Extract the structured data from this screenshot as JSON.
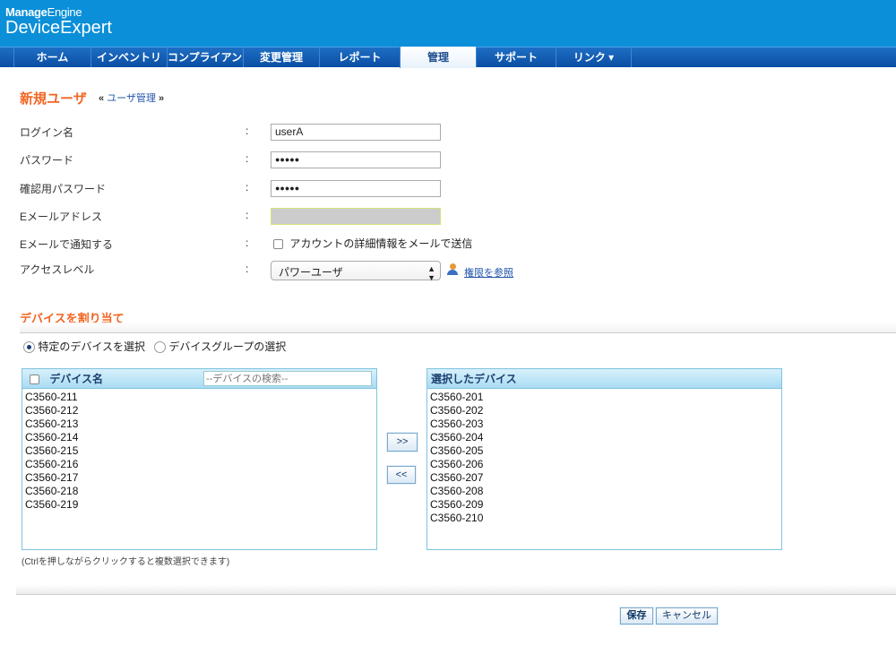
{
  "header": {
    "brand": "ManageEngine",
    "brand_bold": "Manage",
    "brand_light": "Engine",
    "product": "DeviceExpert"
  },
  "nav": {
    "tabs": [
      {
        "label": "ホーム"
      },
      {
        "label": "インベントリ"
      },
      {
        "label": "コンプライアンス"
      },
      {
        "label": "変更管理"
      },
      {
        "label": "レポート"
      },
      {
        "label": "管理",
        "active": true
      },
      {
        "label": "サポート"
      },
      {
        "label": "リンク ▾"
      }
    ]
  },
  "page": {
    "title": "新規ユーザ",
    "breadcrumb": "ユーザ管理",
    "crumb_left": "«",
    "crumb_right": "»"
  },
  "form": {
    "colon": ":",
    "login_label": "ログイン名",
    "login_value": "userA",
    "password_label": "パスワード",
    "password_value": "●●●●●",
    "confirm_label": "確認用パスワード",
    "confirm_value": "●●●●●",
    "email_label": "Eメールアドレス",
    "email_value": "",
    "notify_label": "Eメールで通知する",
    "notify_option": "アカウントの詳細情報をメールで送信",
    "access_label": "アクセスレベル",
    "access_value": "パワーユーザ",
    "permissions_link": "権限を参照"
  },
  "assign": {
    "title": "デバイスを割り当て",
    "radio_specific": "特定のデバイスを選択",
    "radio_group": "デバイスグループの選択",
    "available_header": "デバイス名",
    "search_placeholder": "--デバイスの検索--",
    "available": [
      "C3560-211",
      "C3560-212",
      "C3560-213",
      "C3560-214",
      "C3560-215",
      "C3560-216",
      "C3560-217",
      "C3560-218",
      "C3560-219"
    ],
    "selected_header": "選択したデバイス",
    "selected": [
      "C3560-201",
      "C3560-202",
      "C3560-203",
      "C3560-204",
      "C3560-205",
      "C3560-206",
      "C3560-207",
      "C3560-208",
      "C3560-209",
      "C3560-210"
    ],
    "add_label": ">>",
    "remove_label": "<<",
    "note": "(Ctrlを押しながらクリックすると複数選択できます)"
  },
  "footer": {
    "save": "保存",
    "cancel": "キャンセル"
  }
}
